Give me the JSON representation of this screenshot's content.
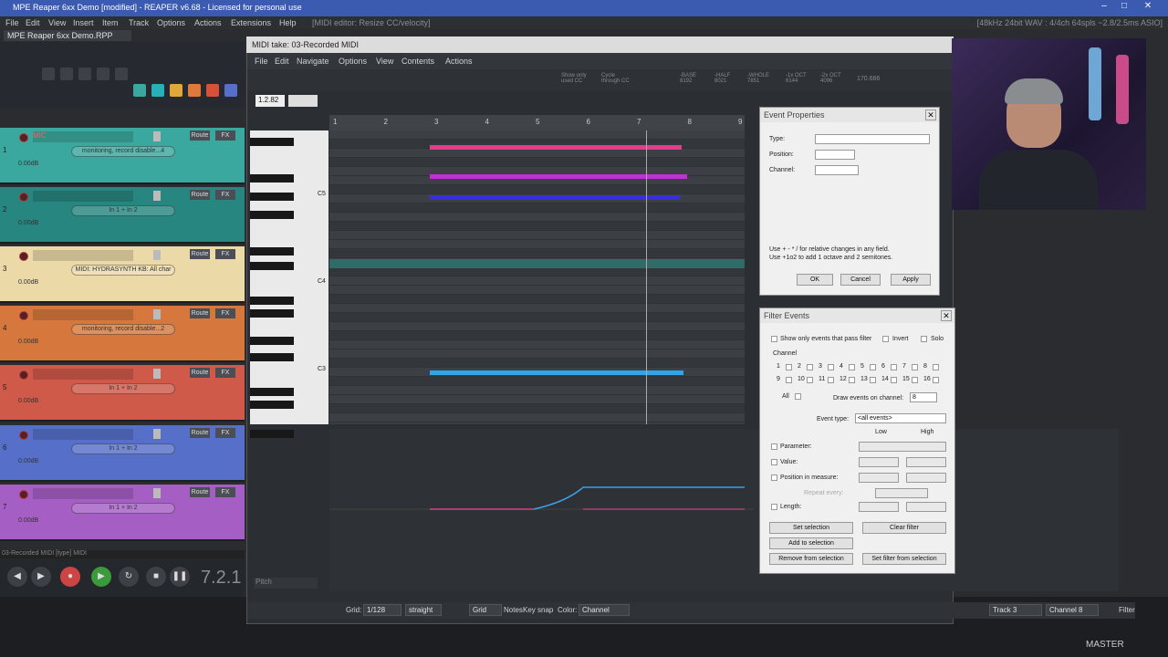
{
  "window_title": "MPE Reaper 6xx Demo [modified] - REAPER v6.68 - Licensed for personal use",
  "main_menu": [
    "File",
    "Edit",
    "View",
    "Insert",
    "Item",
    "Track",
    "Options",
    "Actions",
    "Extensions",
    "Help"
  ],
  "menu_hint": "[MIDI editor: Resize CC/velocity]",
  "status_right": "[48kHz 24bit WAV : 4/4ch 64spls ~2.8/2.5ms ASIO]",
  "project_tab": "MPE Reaper 6xx Demo.RPP",
  "tracks": [
    {
      "num": "1",
      "name": "MIC",
      "input": "monitoring, record disable...4",
      "vol": "0.00dB",
      "color": "#3aa89e"
    },
    {
      "num": "2",
      "name": "",
      "input": "In 1 + In 2",
      "vol": "0.00dB",
      "color": "#27867f"
    },
    {
      "num": "3",
      "name": "",
      "input": "MIDI: HYDRASYNTH KB: All char",
      "vol": "0.00dB",
      "color": "#ecd9a8"
    },
    {
      "num": "4",
      "name": "",
      "input": "monitoring, record disable...2",
      "vol": "0.00dB",
      "color": "#d6783e"
    },
    {
      "num": "5",
      "name": "",
      "input": "In 1 + In 2",
      "vol": "0.00dB",
      "color": "#cf5a4a"
    },
    {
      "num": "6",
      "name": "",
      "input": "In 1 + In 2",
      "vol": "0.00dB",
      "color": "#5670c9"
    },
    {
      "num": "7",
      "name": "",
      "input": "In 1 + In 2",
      "vol": "0.00dB",
      "color": "#a55fc4"
    }
  ],
  "track_buttons": {
    "route": "Route",
    "fx": "FX"
  },
  "item_label": "03-Recorded MIDI [type] MIDI",
  "timecode": "7.2.1",
  "midi": {
    "title": "MIDI take: 03-Recorded MIDI",
    "menu": [
      "File",
      "Edit",
      "Navigate",
      "Options",
      "View",
      "Contents",
      "Actions"
    ],
    "position": "1.2.82",
    "toolbar_info": [
      {
        "label": "Show only used CC"
      },
      {
        "label": "Cycle through CC"
      },
      {
        "label": "-BASE 8192"
      },
      {
        "label": "-HALF 8021"
      },
      {
        "label": "-WHOLE 7851"
      },
      {
        "label": "-1x OCT 6144"
      },
      {
        "label": "-2x OCT 4096"
      },
      {
        "label": "170.666"
      }
    ],
    "ruler": [
      "1",
      "2",
      "3",
      "4",
      "5",
      "6",
      "7",
      "8",
      "9"
    ],
    "key_labels": [
      "C5",
      "C4",
      "C3"
    ],
    "cc_lane_label": "Pitch",
    "bottom": {
      "grid_label": "Grid:",
      "grid_value": "1/128",
      "swing_value": "straight",
      "notes_label": "Notes:",
      "notes_value": "Grid",
      "keysnap_label": "Key snap",
      "color_label": "Color:",
      "color_value": "Channel",
      "track_value": "Track 3",
      "channel_value": "Channel 8",
      "filter_label": "Filter"
    }
  },
  "event_properties": {
    "title": "Event Properties",
    "type_label": "Type:",
    "position_label": "Position:",
    "channel_label": "Channel:",
    "hint1": "Use + - * / for relative changes in any field.",
    "hint2": "Use +1o2 to add 1 octave and 2 semitones.",
    "ok": "OK",
    "cancel": "Cancel",
    "apply": "Apply"
  },
  "filter_events": {
    "title": "Filter Events",
    "show_only": "Show only events that pass filter",
    "invert": "Invert",
    "solo": "Solo",
    "channel_label": "Channel",
    "channels": [
      "1",
      "2",
      "3",
      "4",
      "5",
      "6",
      "7",
      "8",
      "9",
      "10",
      "11",
      "12",
      "13",
      "14",
      "15",
      "16"
    ],
    "all_label": "All",
    "draw_label": "Draw events on channel:",
    "draw_value": "8",
    "event_type_label": "Event type:",
    "event_type_value": "<all events>",
    "low": "Low",
    "high": "High",
    "parameter": "Parameter:",
    "value": "Value:",
    "position_in_measure": "Position in measure:",
    "repeat": "Repeat every:",
    "length": "Length:",
    "set_selection": "Set selection",
    "clear_filter": "Clear filter",
    "add_to_selection": "Add to selection",
    "remove_from_selection": "Remove from selection",
    "set_filter_from_selection": "Set filter from selection"
  },
  "master_label": "MASTER"
}
